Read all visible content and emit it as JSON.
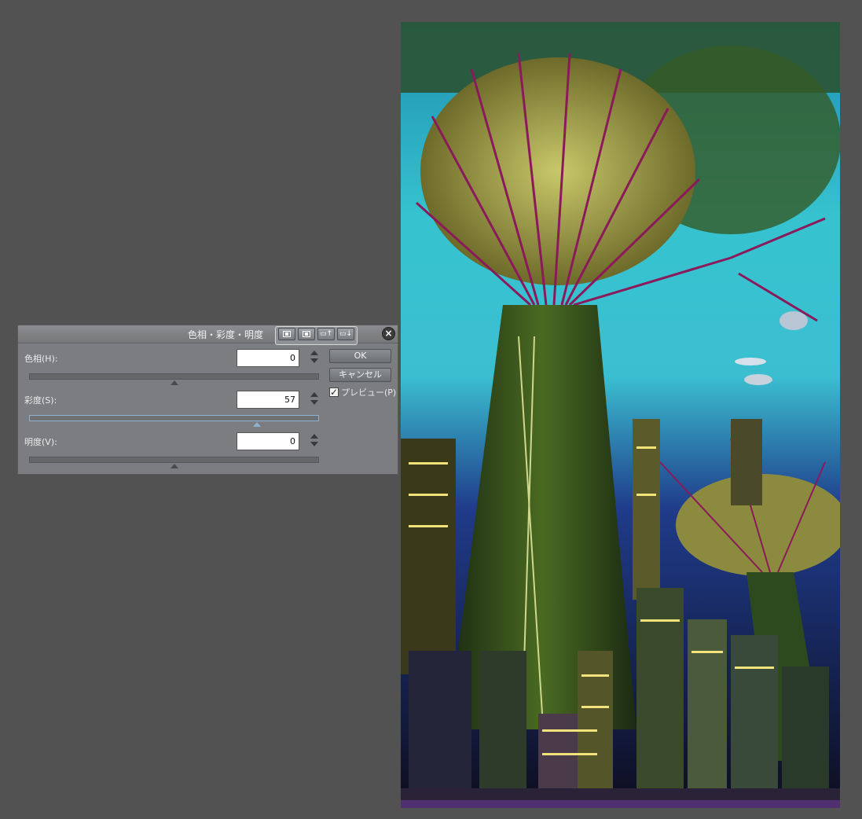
{
  "dialog": {
    "title": "色相・彩度・明度",
    "title_buttons": [
      "dialog-mode-1",
      "dialog-mode-2",
      "save-preset",
      "load-preset"
    ],
    "close_label": "×",
    "hue": {
      "label": "色相(H):",
      "value": "0",
      "slider_percent": 50
    },
    "saturation": {
      "label": "彩度(S):",
      "value": "57",
      "slider_percent": 78.5
    },
    "brightness": {
      "label": "明度(V):",
      "value": "0",
      "slider_percent": 50
    },
    "ok_label": "OK",
    "cancel_label": "キャンセル",
    "preview": {
      "label": "プレビュー(P)",
      "checked": true,
      "check_mark": "✓"
    }
  },
  "canvas": {
    "content": "photo-supertree-city-night"
  }
}
